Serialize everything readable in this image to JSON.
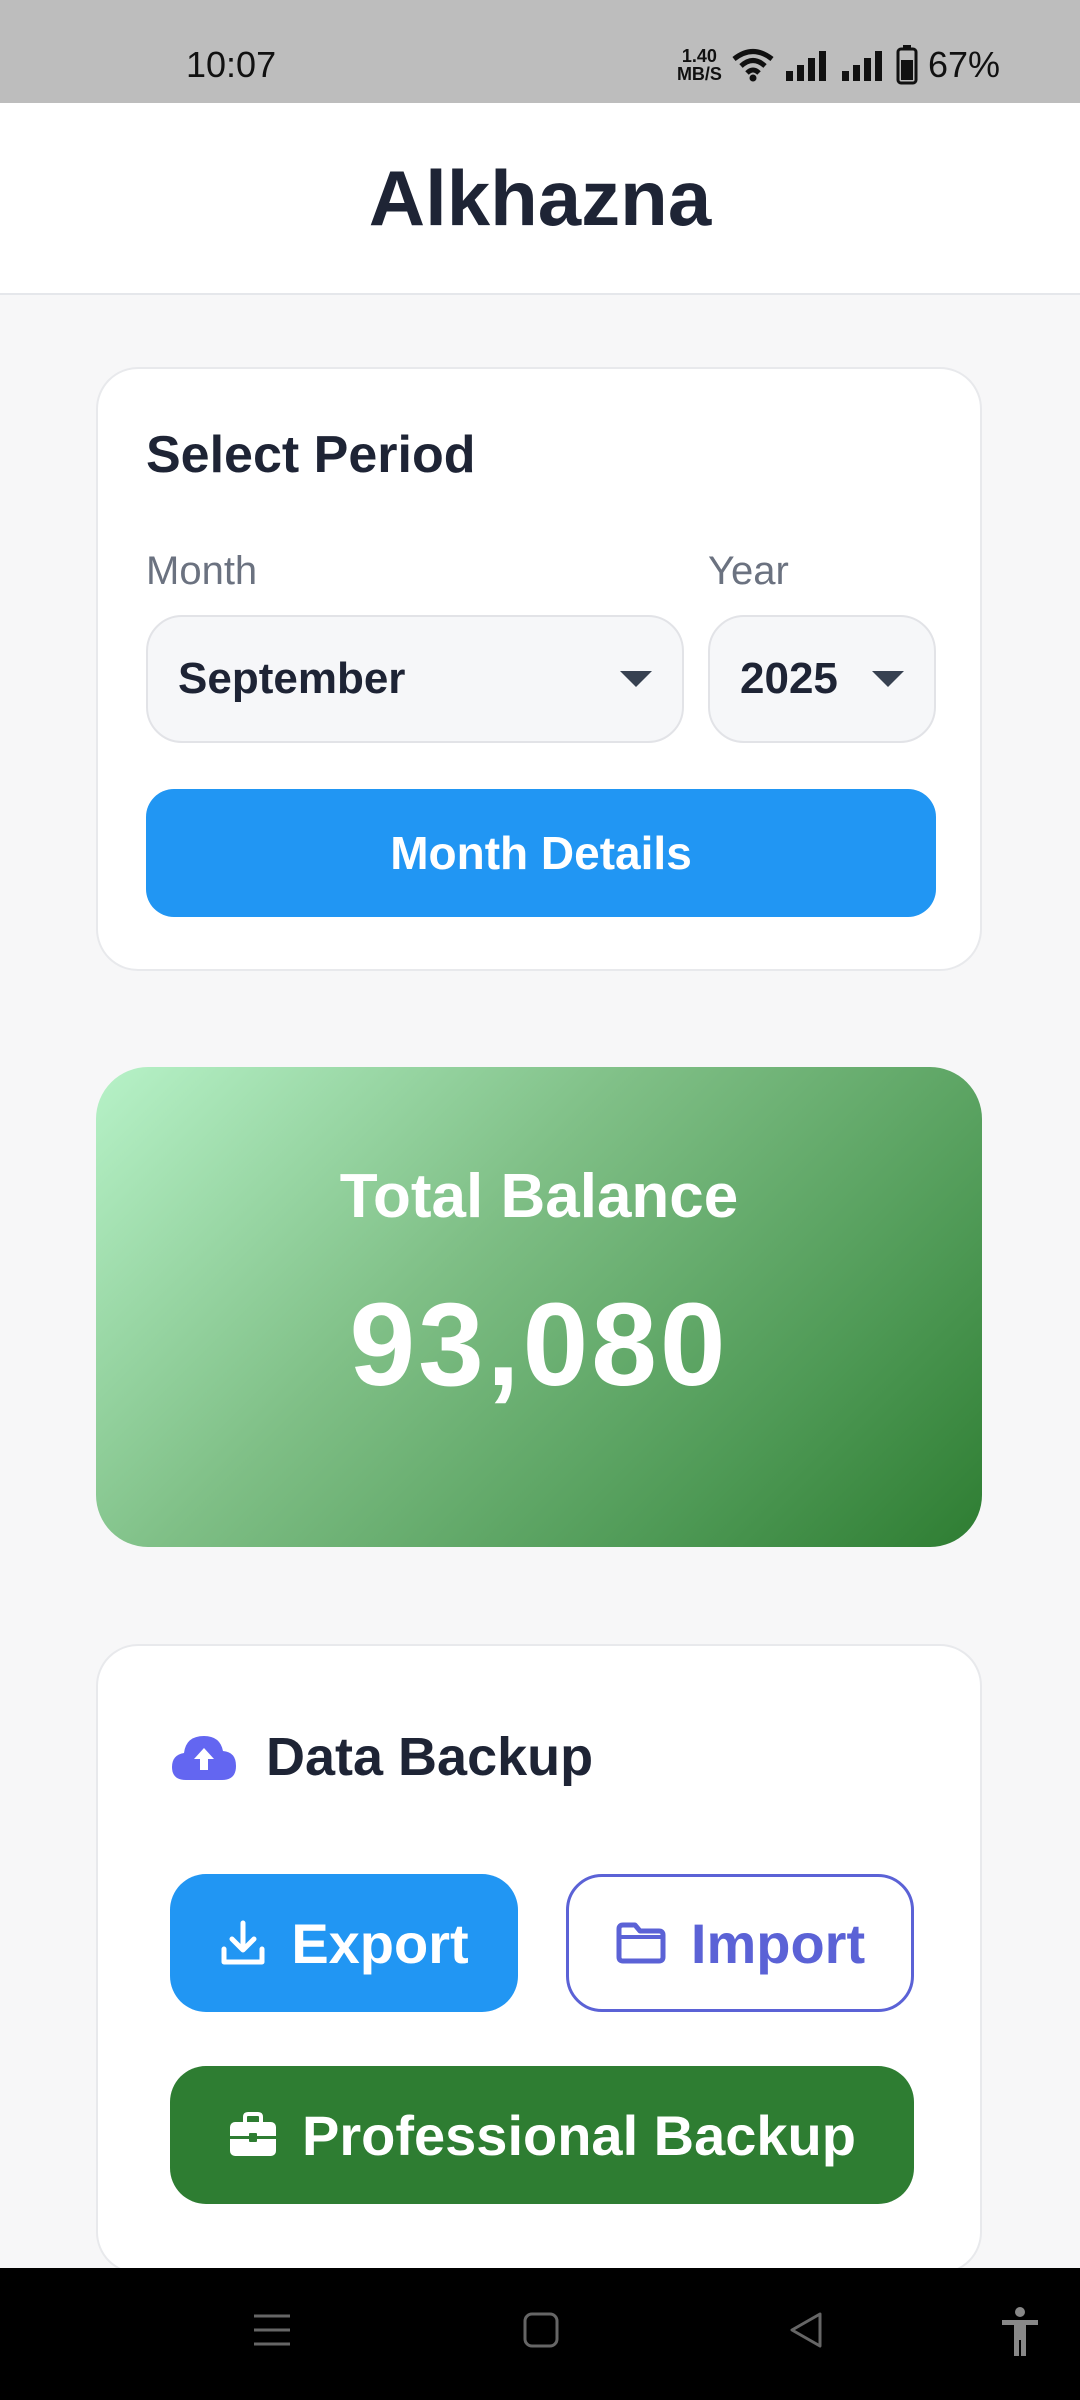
{
  "status_bar": {
    "time": "10:07",
    "net_speed_value": "1.40",
    "net_speed_unit": "MB/S",
    "battery": "67%"
  },
  "app": {
    "title": "Alkhazna"
  },
  "period": {
    "title": "Select Period",
    "month_label": "Month",
    "month_value": "September",
    "year_label": "Year",
    "year_value": "2025",
    "details_button": "Month Details"
  },
  "balance": {
    "label": "Total Balance",
    "value": "93,080"
  },
  "backup": {
    "title": "Data Backup",
    "export_label": "Export",
    "import_label": "Import",
    "professional_label": "Professional Backup"
  },
  "icons": {
    "cloud_upload": "cloud-upload-icon",
    "download": "download-icon",
    "folder": "folder-icon",
    "briefcase": "briefcase-icon"
  },
  "colors": {
    "primary": "#2196f3",
    "accent_purple": "#5b62d6",
    "success_green": "#2e7d32",
    "text_dark": "#1e2435"
  }
}
